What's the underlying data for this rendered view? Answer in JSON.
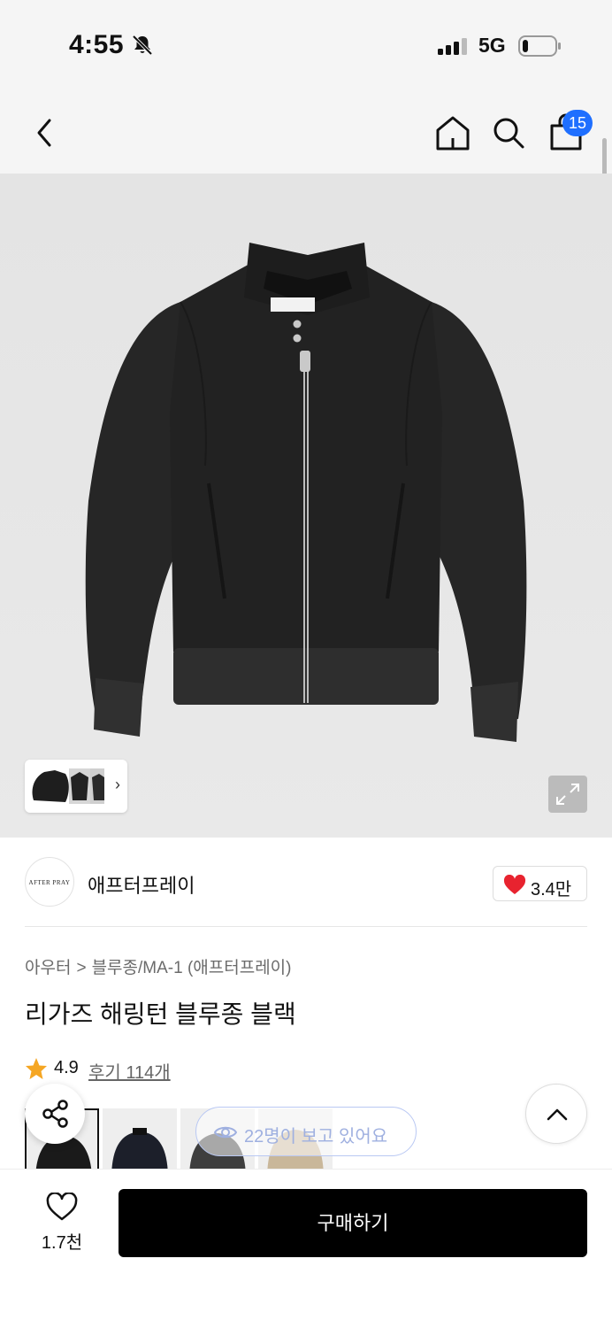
{
  "status_bar": {
    "time": "4:55",
    "network": "5G"
  },
  "nav": {
    "cart_count": "15"
  },
  "brand": {
    "name": "애프터프레이",
    "logo_text": "AFTER PRAY",
    "like_count": "3.4만"
  },
  "breadcrumb": {
    "category": "아우터",
    "separator": ">",
    "subcategory": "블루종/MA-1 (애프터프레이)"
  },
  "product": {
    "title": "리가즈 해링턴 블루종 블랙",
    "rating": "4.9",
    "review_label": "후기 114개"
  },
  "viewers": {
    "text": "22명이 보고 있어요"
  },
  "bottom_bar": {
    "wish_count": "1.7천",
    "buy_label": "구매하기"
  },
  "icons": [
    "bell-slash-icon",
    "signal-icon",
    "battery-icon",
    "back-icon",
    "home-icon",
    "search-icon",
    "bag-icon",
    "expand-icon",
    "heart-icon",
    "star-icon",
    "share-icon",
    "eye-icon",
    "chevron-up-icon"
  ],
  "colors": {
    "badge": "#1f6fff",
    "heart": "#e8232f",
    "star": "#f5a623",
    "buy_button": "#000000"
  }
}
